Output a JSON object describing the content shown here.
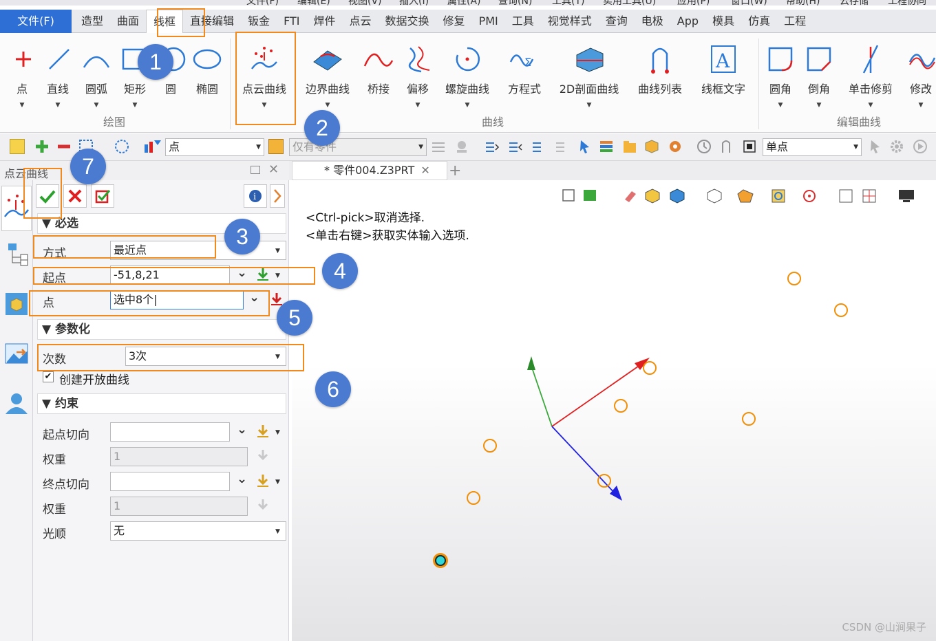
{
  "titlebar": {
    "items": [
      "文件(F)",
      "编辑(E)",
      "视图(V)",
      "插入(I)",
      "属性(A)",
      "查询(N)",
      "工具(T)",
      "实用工具(U)",
      "应用(P)",
      "窗口(W)",
      "帮助(H)",
      "云存储",
      "工程协同"
    ]
  },
  "tabs": [
    {
      "label": "文件(F)"
    },
    {
      "label": "造型"
    },
    {
      "label": "曲面"
    },
    {
      "label": "线框"
    },
    {
      "label": "直接编辑"
    },
    {
      "label": "钣金"
    },
    {
      "label": "FTI"
    },
    {
      "label": "焊件"
    },
    {
      "label": "点云"
    },
    {
      "label": "数据交换"
    },
    {
      "label": "修复"
    },
    {
      "label": "PMI"
    },
    {
      "label": "工具"
    },
    {
      "label": "视觉样式"
    },
    {
      "label": "查询"
    },
    {
      "label": "电极"
    },
    {
      "label": "App"
    },
    {
      "label": "模具"
    },
    {
      "label": "仿真"
    },
    {
      "label": "工程"
    }
  ],
  "ribbon": {
    "buttons": [
      "点",
      "直线",
      "圆弧",
      "矩形",
      "圆",
      "椭圆",
      "点云曲线",
      "边界曲线",
      "桥接",
      "偏移",
      "螺旋曲线",
      "方程式",
      "2D剖面曲线",
      "曲线列表",
      "线框文字",
      "圆角",
      "倒角",
      "单击修剪",
      "修改"
    ],
    "groups": [
      "绘图",
      "曲线",
      "编辑曲线"
    ]
  },
  "toolbar": {
    "filter_value": "点",
    "scope_value": "仅有零件",
    "pick_mode_value": "单点"
  },
  "panel": {
    "title": "点云曲线",
    "sections": {
      "required": "必选",
      "params": "参数化",
      "constraints": "约束"
    },
    "method_label": "方式",
    "method_value": "最近点",
    "start_label": "起点",
    "start_value": "-51,8,21",
    "points_label": "点",
    "points_value": "选中8个",
    "degree_label": "次数",
    "degree_value": "3次",
    "open_curve_label": "创建开放曲线",
    "start_tangent_label": "起点切向",
    "weight1_label": "权重",
    "weight1_value": "1",
    "end_tangent_label": "终点切向",
    "weight2_label": "权重",
    "weight2_value": "1",
    "smooth_label": "光顺",
    "smooth_value": "无"
  },
  "doc_tab": {
    "label": "* 零件004.Z3PRT"
  },
  "viewport": {
    "hint1": "<Ctrl-pick>取消选择.",
    "hint2": "<单击右键>获取实体输入选项.",
    "watermark": "CSDN @山涧果子"
  },
  "callouts": [
    "1",
    "2",
    "3",
    "4",
    "5",
    "6",
    "7"
  ],
  "colors": {
    "accent": "#2e6fd6",
    "highlight": "#f08a1e",
    "bubble": "#4a7bd0"
  }
}
